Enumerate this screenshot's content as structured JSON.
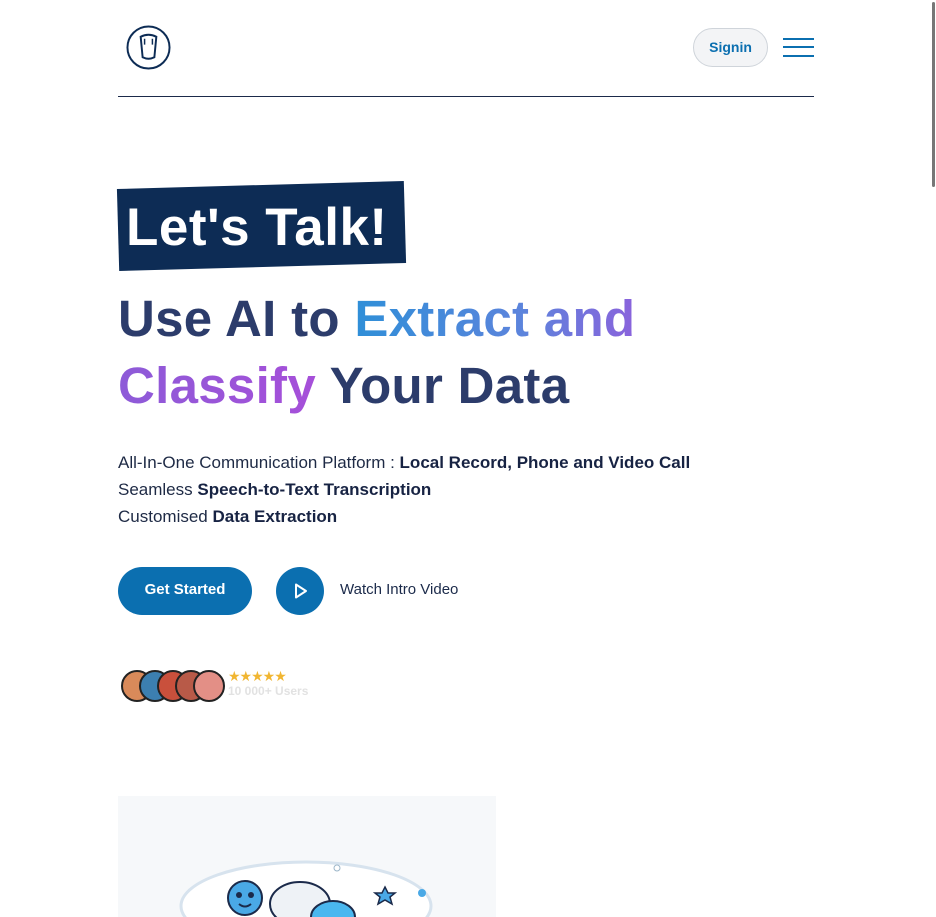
{
  "header": {
    "signin_label": "Signin"
  },
  "hero": {
    "badge": "Let's Talk!",
    "headline": {
      "line1_a": "Use AI to ",
      "line1_b": "Extract and",
      "line2_a": "Classify",
      "line2_b": " Your Data"
    },
    "features": [
      {
        "plain": "All-In-One Communication Platform : ",
        "bold": "Local Record, Phone and Video Call"
      },
      {
        "plain": "Seamless ",
        "bold": "Speech-to-Text Transcription"
      },
      {
        "plain": "Customised ",
        "bold": "Data Extraction"
      }
    ],
    "cta_label": "Get Started",
    "video_label": "Watch Intro Video"
  },
  "social_proof": {
    "rating_stars": "★★★★★",
    "users_label": "10 000+ Users"
  },
  "colors": {
    "primary": "#0b6fb0",
    "navy": "#0d2c55",
    "heading": "#2c3c6b",
    "gradient_blue": "#2f8fd8",
    "gradient_purple": "#a64fd9"
  }
}
